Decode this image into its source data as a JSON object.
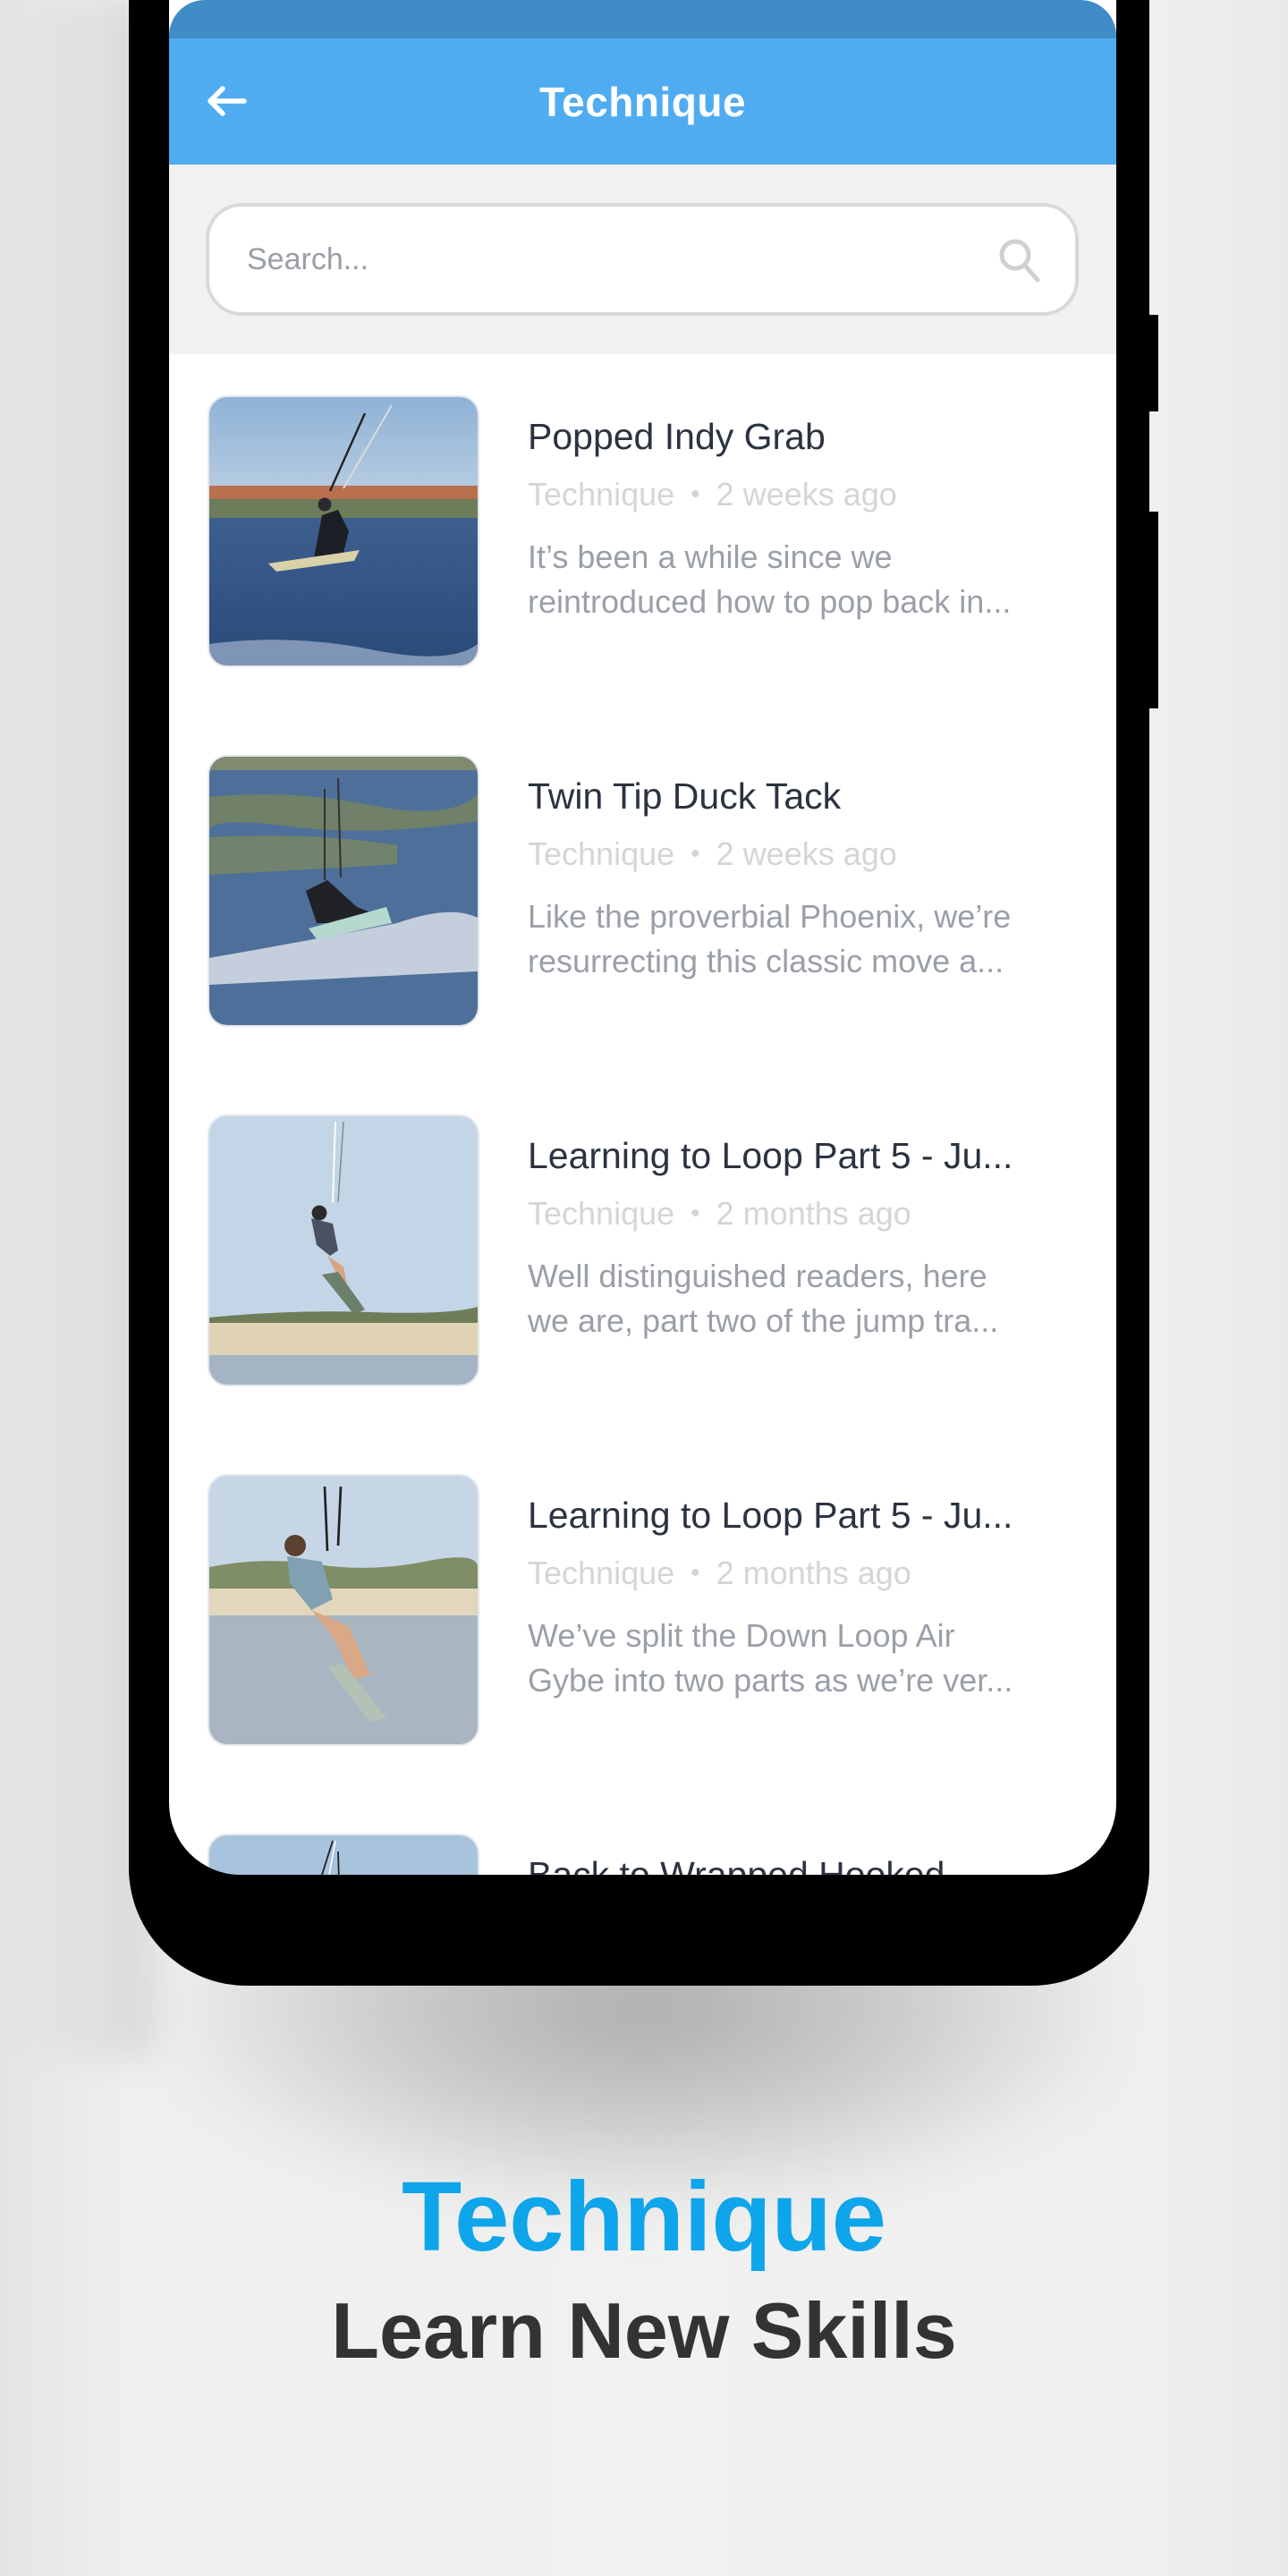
{
  "colors": {
    "status_bar": "#3f8cc7",
    "app_bar": "#50acf0",
    "caption_accent": "#0ea5ea",
    "caption_dark": "#333333"
  },
  "app_bar": {
    "title": "Technique",
    "back_icon": "arrow-left-icon"
  },
  "search": {
    "placeholder": "Search...",
    "value": "",
    "icon": "search-icon"
  },
  "articles": [
    {
      "title": "Popped Indy Grab",
      "category": "Technique",
      "separator": "•",
      "time": "2 weeks ago",
      "excerpt_line1": "It’s been a while since we",
      "excerpt_line2": "reintroduced how to pop back in...",
      "thumbnail": "kitesurfer-on-water-town-background"
    },
    {
      "title": "Twin Tip Duck Tack",
      "category": "Technique",
      "separator": "•",
      "time": "2 weeks ago",
      "excerpt_line1": "Like the proverbial Phoenix, we’re",
      "excerpt_line2": "resurrecting this classic move a...",
      "thumbnail": "kitesurfer-carving-spray"
    },
    {
      "title": "Learning to Loop Part 5 - Ju...",
      "category": "Technique",
      "separator": "•",
      "time": "2 months ago",
      "excerpt_line1": "Well distinguished readers, here",
      "excerpt_line2": "we are, part two of the jump tra...",
      "thumbnail": "kitesurfer-jumping-beach"
    },
    {
      "title": "Learning to Loop Part 5 - Ju...",
      "category": "Technique",
      "separator": "•",
      "time": "2 months ago",
      "excerpt_line1": "We’ve split the Down Loop Air",
      "excerpt_line2": "Gybe into two parts as we’re ver...",
      "thumbnail": "kitesurfer-jumping-closeup"
    },
    {
      "title": "Back to Wrapped Hooked",
      "category": "",
      "separator": "",
      "time": "",
      "excerpt_line1": "",
      "excerpt_line2": "",
      "thumbnail": "kite-lines-sky"
    }
  ],
  "caption": {
    "title": "Technique",
    "subtitle": "Learn New Skills"
  }
}
